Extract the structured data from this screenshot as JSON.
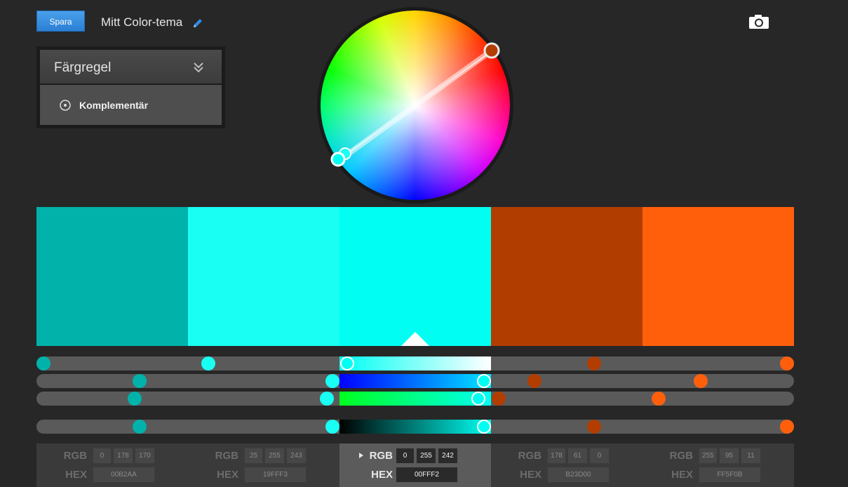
{
  "toolbar": {
    "save_label": "Spara",
    "theme_title": "Mitt Color-tema"
  },
  "rule_panel": {
    "header": "Färgregel",
    "selected_rule": "Komplementär"
  },
  "colors": [
    {
      "hex": "00B2AA",
      "rgb": [
        "0",
        "178",
        "170"
      ],
      "css": "#00b2aa"
    },
    {
      "hex": "19FFF3",
      "rgb": [
        "25",
        "255",
        "243"
      ],
      "css": "#19fff3"
    },
    {
      "hex": "00FFF2",
      "rgb": [
        "0",
        "255",
        "242"
      ],
      "css": "#00fff2"
    },
    {
      "hex": "B23D00",
      "rgb": [
        "178",
        "61",
        "0"
      ],
      "css": "#b23d00"
    },
    {
      "hex": "FF5F0B",
      "rgb": [
        "255",
        "95",
        "11"
      ],
      "css": "#ff5f0b"
    }
  ],
  "active_index": 2,
  "labels": {
    "rgb": "RGB",
    "hex": "HEX"
  },
  "sliders": {
    "saturation": [
      0.0,
      0.227,
      0.41,
      0.736,
      1.0
    ],
    "hue": [
      0.136,
      0.391,
      0.591,
      0.657,
      0.877
    ],
    "green": [
      0.13,
      0.383,
      0.583,
      0.61,
      0.821
    ],
    "brightness": [
      0.136,
      0.391,
      0.591,
      0.736,
      1.0
    ]
  }
}
